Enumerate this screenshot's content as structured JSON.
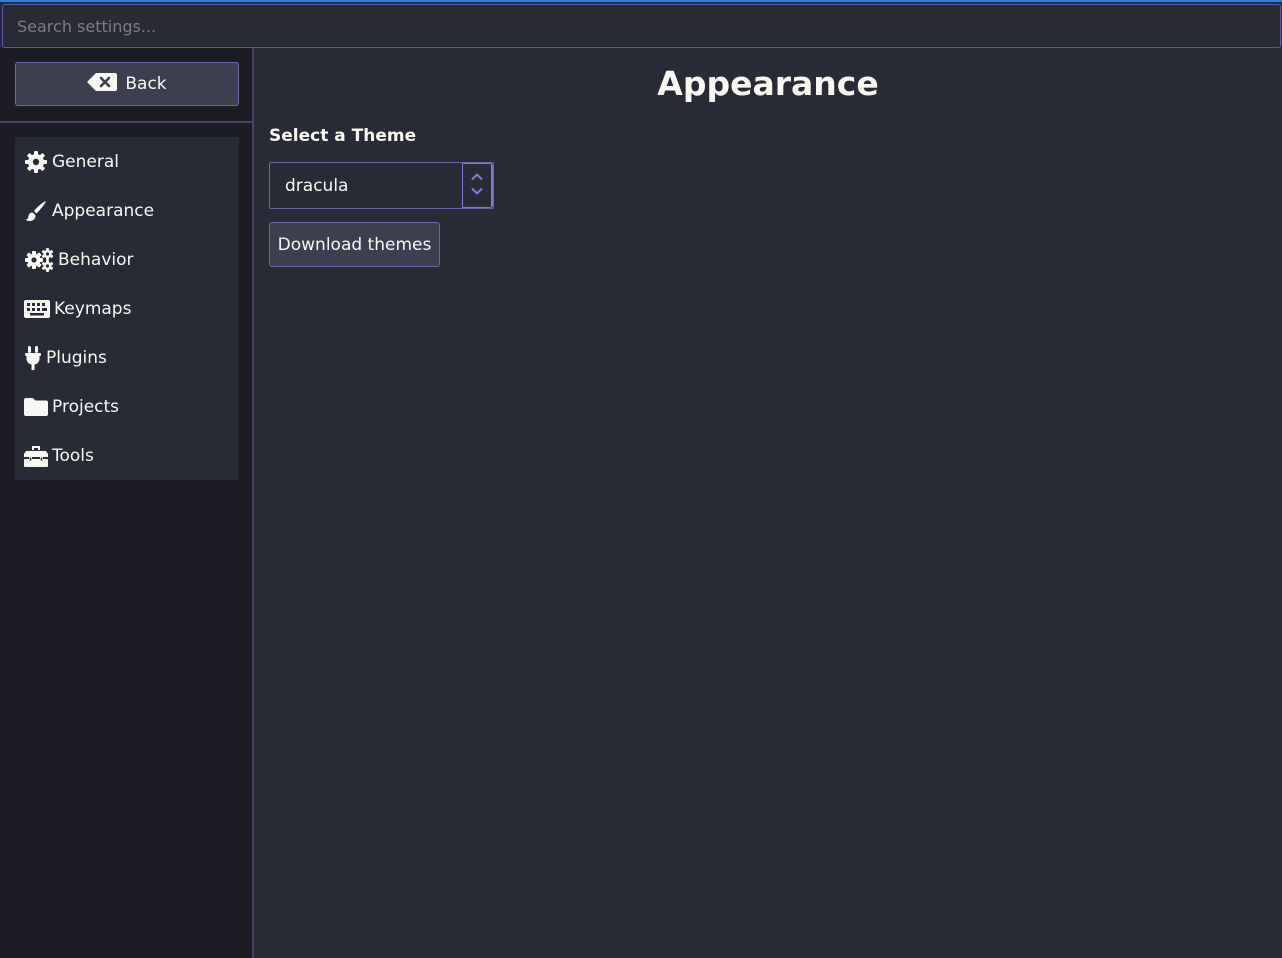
{
  "search": {
    "placeholder": "Search settings..."
  },
  "sidebar": {
    "back_label": "Back",
    "items": [
      {
        "label": "General",
        "icon": "gear-icon"
      },
      {
        "label": "Appearance",
        "icon": "paintbrush-icon"
      },
      {
        "label": "Behavior",
        "icon": "gears-icon"
      },
      {
        "label": "Keymaps",
        "icon": "keyboard-icon"
      },
      {
        "label": "Plugins",
        "icon": "plug-icon"
      },
      {
        "label": "Projects",
        "icon": "folder-icon"
      },
      {
        "label": "Tools",
        "icon": "toolbox-icon"
      }
    ]
  },
  "main": {
    "title": "Appearance",
    "theme_label": "Select a Theme",
    "theme_value": "dracula",
    "download_label": "Download themes"
  },
  "colors": {
    "background": "#282a36",
    "sidebar_background": "#1c1c25",
    "accent": "#7f7bd6",
    "button_background": "#3d3f51",
    "text": "#f8f8f2"
  }
}
